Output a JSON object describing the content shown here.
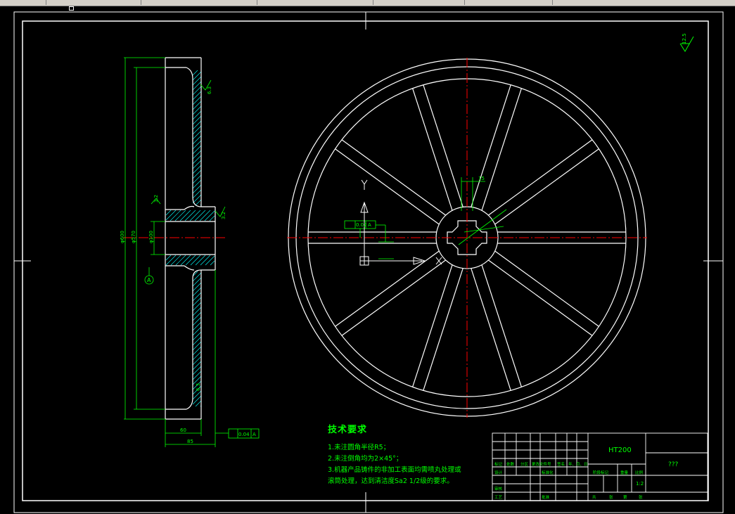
{
  "drawing": {
    "material": "HT200",
    "name_cell": "???",
    "scale": "1:2",
    "roughness_default": "12.5",
    "tech_req": {
      "title": "技术要求",
      "items": [
        "1.未注圆角半径R5；",
        "2.未注倒角均为2×45°；",
        "3.机器产品铸件的非加工表面均需喷丸处理或",
        "滚筒处理，达到清洁度Sa2 1/2级的要求。"
      ]
    },
    "section_dims": {
      "d600": "φ600",
      "d570": "φ570",
      "d100": "φ100",
      "w60": "60",
      "w85": "85",
      "r63a": "6.3",
      "r63b": "6.3",
      "r32a": "3.2",
      "r32b": "3.2",
      "datum": "A",
      "runout_tol": "0.04",
      "runout_ref": "A"
    },
    "front_dims": {
      "spoke_w": "15",
      "pos_tol": "0.02",
      "pos_ref": "A",
      "ucs_y": "Y",
      "ucs_x": "X"
    },
    "title_block": {
      "labels": [
        "标记",
        "处数",
        "分区",
        "更改文件号",
        "签名",
        "年、月、日",
        "设计",
        "标准化",
        "审核",
        "工艺",
        "批准",
        "阶段标记",
        "重量",
        "比例",
        "共",
        "张",
        "第",
        "张"
      ]
    },
    "colors": {
      "line": "#ffffff",
      "dim": "#00ff00",
      "center": "#ff0000",
      "hatch": "#00ffff"
    }
  }
}
